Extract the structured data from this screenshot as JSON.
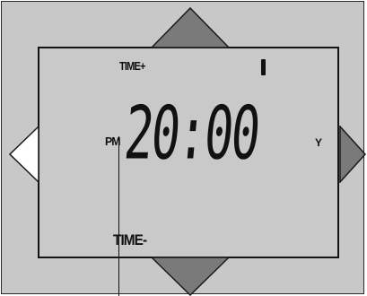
{
  "display": {
    "time_plus_label": "TIME+",
    "time_minus_label": "TIME-",
    "ampm_label": "PM",
    "time_value": "20:00",
    "day_indicator": "Y",
    "channel_indicator": "|"
  },
  "buttons": {
    "up": "up-arrow",
    "down": "down-arrow",
    "left": "left-arrow",
    "right": "right-arrow"
  },
  "colors": {
    "device_body": "#c8c8c8",
    "lcd_screen": "#c9c9c9",
    "arrow_fill_dark": "#7a7a7a",
    "arrow_fill_light": "#ffffff",
    "segment_color": "#111111"
  }
}
